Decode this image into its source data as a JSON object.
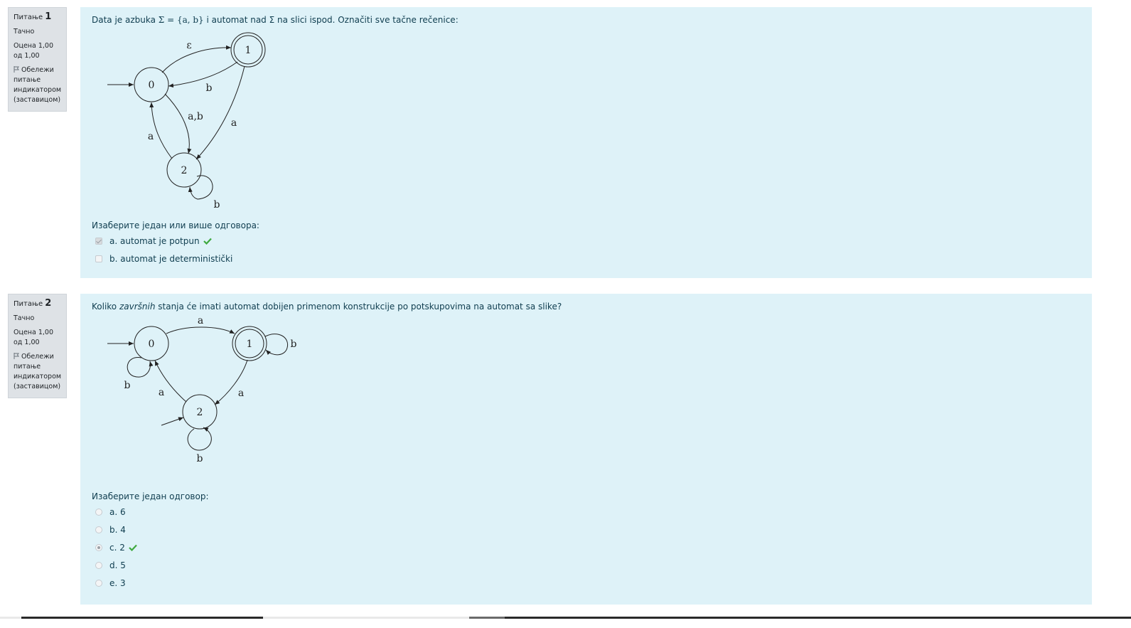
{
  "q1": {
    "info": {
      "label": "Питање",
      "number": "1",
      "state": "Тачно",
      "grade": "Оцена 1,00 од 1,00",
      "flag": "Обележи питање индикатором (заставицом)"
    },
    "text_before": "Data je azbuka ",
    "math": "Σ = {a, b}",
    "text_after": " i automat nad Σ na slici ispod. Označiti sve tačne rečenice:",
    "diagram": {
      "states": [
        "0",
        "1",
        "2"
      ],
      "labels": {
        "e": "ε",
        "b01": "b",
        "ab": "a,b",
        "a20": "a",
        "a12": "a",
        "loop2": "b"
      }
    },
    "prompt": "Изаберите један или више одговора:",
    "options": [
      {
        "label": "a. automat je potpun",
        "checked": true,
        "correct": true
      },
      {
        "label": "b. automat je deterministički",
        "checked": false,
        "correct": false
      }
    ]
  },
  "q2": {
    "info": {
      "label": "Питање",
      "number": "2",
      "state": "Тачно",
      "grade": "Оцена 1,00 од 1,00",
      "flag": "Обележи питање индикатором (заставицом)"
    },
    "text_before": "Koliko ",
    "text_em": "završnih",
    "text_after": " stanja će imati automat dobijen primenom konstrukcije po potskupovima na automat sa slike?",
    "diagram": {
      "states": [
        "0",
        "1",
        "2"
      ],
      "labels": {
        "a01": "a",
        "loop1": "b",
        "loop0": "b",
        "a20": "a",
        "a12": "a",
        "loop2": "b"
      }
    },
    "prompt": "Изаберите један одговор:",
    "options": [
      {
        "label": "a. 6",
        "checked": false,
        "correct": false
      },
      {
        "label": "b. 4",
        "checked": false,
        "correct": false
      },
      {
        "label": "c. 2",
        "checked": true,
        "correct": true
      },
      {
        "label": "d. 5",
        "checked": false,
        "correct": false
      },
      {
        "label": "e. 3",
        "checked": false,
        "correct": false
      }
    ]
  },
  "colors": {
    "check": "#3fa93f",
    "panel": "#def2f8",
    "info": "#dee2e6",
    "text": "#0f3d4f"
  },
  "icons": {
    "flag": "flag-icon",
    "tick": "check-icon"
  }
}
